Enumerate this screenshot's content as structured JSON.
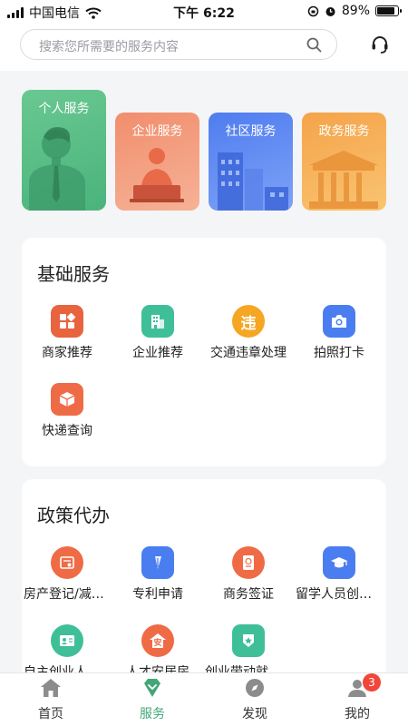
{
  "status_bar": {
    "carrier": "中国电信",
    "time": "下午 6:22",
    "battery": "89%"
  },
  "search": {
    "placeholder": "搜索您所需要的服务内容"
  },
  "banners": [
    {
      "label": "个人服务"
    },
    {
      "label": "企业服务"
    },
    {
      "label": "社区服务"
    },
    {
      "label": "政务服务"
    }
  ],
  "sections": [
    {
      "title": "基础服务",
      "items": [
        {
          "label": "商家推荐",
          "icon": "apps-icon",
          "color": "#e8643f"
        },
        {
          "label": "企业推荐",
          "icon": "building-icon",
          "color": "#3fbf97"
        },
        {
          "label": "交通违章处理",
          "icon": "traffic-violation-icon",
          "glyph": "违",
          "color": "#f5a623"
        },
        {
          "label": "拍照打卡",
          "icon": "camera-icon",
          "color": "#4a7ef0"
        },
        {
          "label": "快递查询",
          "icon": "package-icon",
          "color": "#ef6b45"
        }
      ]
    },
    {
      "title": "政策代办",
      "items": [
        {
          "label": "房产登记/减免税费",
          "icon": "certificate-icon",
          "color": "#ef6b45"
        },
        {
          "label": "专利申请",
          "icon": "patent-icon",
          "color": "#4a7ef0"
        },
        {
          "label": "商务签证",
          "icon": "passport-icon",
          "color": "#ef6b45"
        },
        {
          "label": "留学人员创业补贴",
          "icon": "graduation-cap-icon",
          "color": "#4a7ef0"
        },
        {
          "label": "自主创业人员补贴",
          "icon": "id-card-icon",
          "color": "#3fbf97"
        },
        {
          "label": "人才安居房",
          "icon": "house-icon",
          "glyph": "安",
          "color": "#ef6b45"
        },
        {
          "label": "创业带动就业补贴",
          "icon": "badge-star-icon",
          "color": "#3fbf97"
        }
      ]
    }
  ],
  "tabbar": {
    "tabs": [
      {
        "label": "首页",
        "icon": "home-icon"
      },
      {
        "label": "服务",
        "icon": "service-icon",
        "active": true
      },
      {
        "label": "发现",
        "icon": "compass-icon"
      },
      {
        "label": "我的",
        "icon": "user-icon",
        "badge": "3"
      }
    ]
  },
  "colors": {
    "accent": "#43a678",
    "badge": "#f0473a"
  }
}
